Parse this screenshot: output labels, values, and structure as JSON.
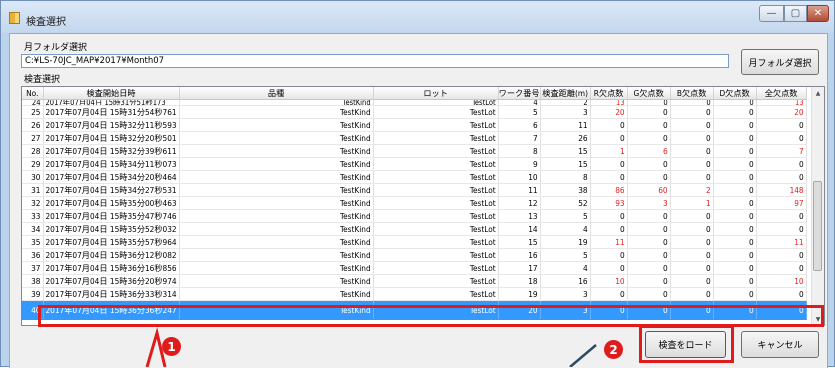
{
  "window": {
    "title": "検査選択",
    "controls": [
      "—",
      "▢",
      "✕"
    ]
  },
  "folder": {
    "label": "月フォルダ選択",
    "path": "C:¥LS-70JC_MAP¥2017¥Month07",
    "button_label": "月フォルダ選択"
  },
  "inspection": {
    "label": "検査選択",
    "columns": [
      "No.",
      "検査開始日時",
      "品種",
      "ロット",
      "ワーク番号",
      "検査距離(m)",
      "R欠点数",
      "G欠点数",
      "B欠点数",
      "D欠点数",
      "全欠点数"
    ],
    "rows": [
      [
        "24",
        "2017年07月04日 15時31分51秒173",
        "TestKind",
        "TestLot",
        "4",
        "2",
        "13",
        "0",
        "0",
        "0",
        "13"
      ],
      [
        "25",
        "2017年07月04日 15時31分54秒761",
        "TestKind",
        "TestLot",
        "5",
        "3",
        "20",
        "0",
        "0",
        "0",
        "20"
      ],
      [
        "26",
        "2017年07月04日 15時32分11秒593",
        "TestKind",
        "TestLot",
        "6",
        "11",
        "0",
        "0",
        "0",
        "0",
        "0"
      ],
      [
        "27",
        "2017年07月04日 15時32分20秒501",
        "TestKind",
        "TestLot",
        "7",
        "26",
        "0",
        "0",
        "0",
        "0",
        "0"
      ],
      [
        "28",
        "2017年07月04日 15時32分39秒611",
        "TestKind",
        "TestLot",
        "8",
        "15",
        "1",
        "6",
        "0",
        "0",
        "7"
      ],
      [
        "29",
        "2017年07月04日 15時34分11秒073",
        "TestKind",
        "TestLot",
        "9",
        "15",
        "0",
        "0",
        "0",
        "0",
        "0"
      ],
      [
        "30",
        "2017年07月04日 15時34分20秒464",
        "TestKind",
        "TestLot",
        "10",
        "8",
        "0",
        "0",
        "0",
        "0",
        "0"
      ],
      [
        "31",
        "2017年07月04日 15時34分27秒531",
        "TestKind",
        "TestLot",
        "11",
        "38",
        "86",
        "60",
        "2",
        "0",
        "148"
      ],
      [
        "32",
        "2017年07月04日 15時35分00秒463",
        "TestKind",
        "TestLot",
        "12",
        "52",
        "93",
        "3",
        "1",
        "0",
        "97"
      ],
      [
        "33",
        "2017年07月04日 15時35分47秒746",
        "TestKind",
        "TestLot",
        "13",
        "5",
        "0",
        "0",
        "0",
        "0",
        "0"
      ],
      [
        "34",
        "2017年07月04日 15時35分52秒032",
        "TestKind",
        "TestLot",
        "14",
        "4",
        "0",
        "0",
        "0",
        "0",
        "0"
      ],
      [
        "35",
        "2017年07月04日 15時35分57秒964",
        "TestKind",
        "TestLot",
        "15",
        "19",
        "11",
        "0",
        "0",
        "0",
        "11"
      ],
      [
        "36",
        "2017年07月04日 15時36分12秒082",
        "TestKind",
        "TestLot",
        "16",
        "5",
        "0",
        "0",
        "0",
        "0",
        "0"
      ],
      [
        "37",
        "2017年07月04日 15時36分16秒856",
        "TestKind",
        "TestLot",
        "17",
        "4",
        "0",
        "0",
        "0",
        "0",
        "0"
      ],
      [
        "38",
        "2017年07月04日 15時36分20秒974",
        "TestKind",
        "TestLot",
        "18",
        "16",
        "10",
        "0",
        "0",
        "0",
        "10"
      ],
      [
        "39",
        "2017年07月04日 15時36分33秒314",
        "TestKind",
        "TestLot",
        "19",
        "3",
        "0",
        "0",
        "0",
        "0",
        "0"
      ],
      [
        "40",
        "2017年07月04日 15時36分36秒247",
        "TestKind",
        "TestLot",
        "20",
        "3",
        "0",
        "0",
        "0",
        "0",
        "0"
      ]
    ],
    "selected_row": "40"
  },
  "buttons": {
    "load": "検査をロード",
    "cancel": "キャンセル"
  },
  "annotations": {
    "badge1": "1",
    "badge2": "2",
    "highlight_color": "#e01b1b"
  },
  "colors": {
    "selection": "#3399ff",
    "defect_red": "#e02020"
  }
}
